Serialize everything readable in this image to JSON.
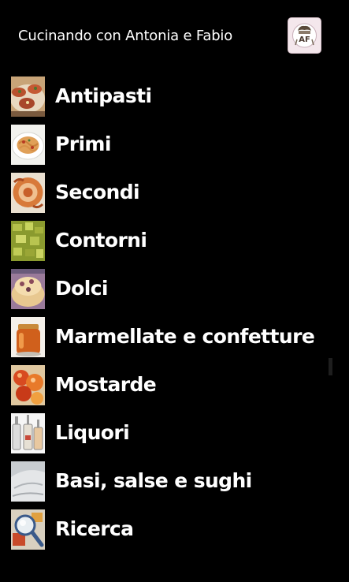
{
  "app": {
    "title": "Cucinando con Antonia e Fabio",
    "logo_icon": "chef-logo-icon",
    "background": "#000000",
    "text_color": "#ffffff"
  },
  "menu": {
    "items": [
      {
        "label": "Antipasti",
        "icon": "antipasti-thumbnail"
      },
      {
        "label": "Primi",
        "icon": "primi-thumbnail"
      },
      {
        "label": "Secondi",
        "icon": "secondi-thumbnail"
      },
      {
        "label": "Contorni",
        "icon": "contorni-thumbnail"
      },
      {
        "label": "Dolci",
        "icon": "dolci-thumbnail"
      },
      {
        "label": "Marmellate e confetture",
        "icon": "marmellate-thumbnail"
      },
      {
        "label": "Mostarde",
        "icon": "mostarde-thumbnail"
      },
      {
        "label": "Liquori",
        "icon": "liquori-thumbnail"
      },
      {
        "label": "Basi, salse e sughi",
        "icon": "basi-thumbnail"
      },
      {
        "label": "Ricerca",
        "icon": "search-thumbnail"
      }
    ]
  }
}
